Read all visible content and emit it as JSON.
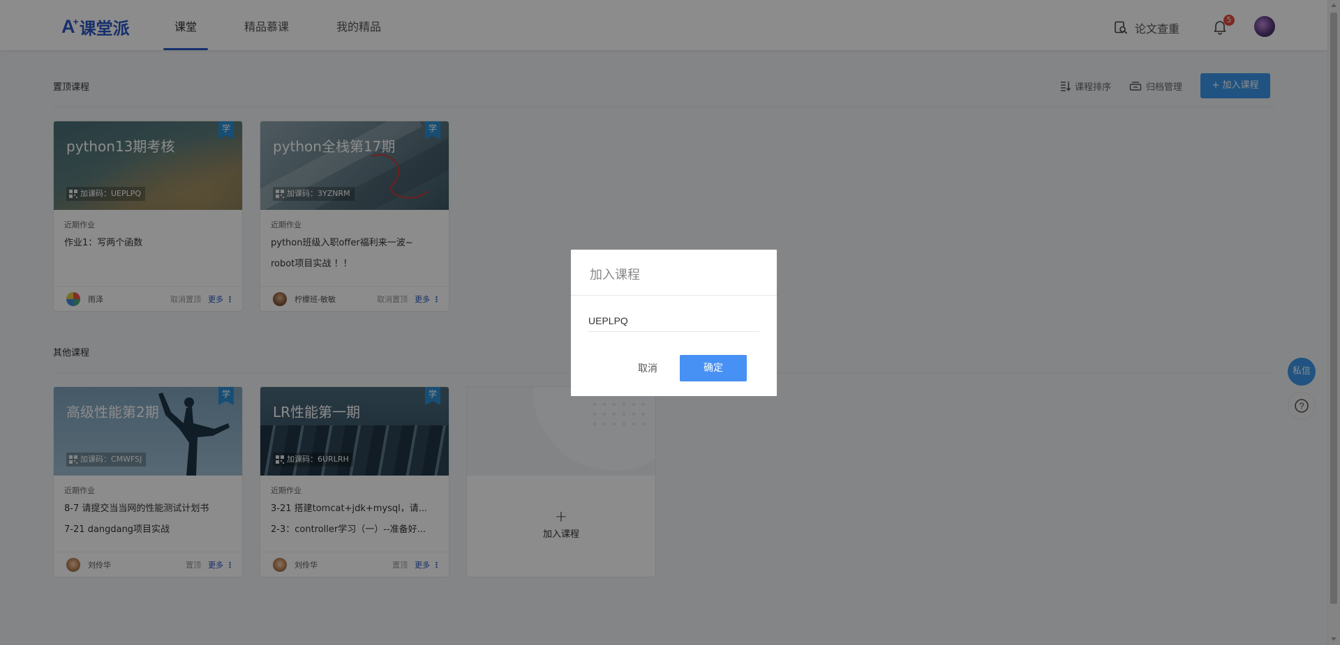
{
  "header": {
    "logo_mark": "A",
    "logo_sup": "+",
    "logo_text": "课堂派",
    "nav": [
      "课堂",
      "精品慕课",
      "我的精品"
    ],
    "plagiarism_label": "论文查重",
    "notification_count": "5"
  },
  "pinned": {
    "title": "置顶课程",
    "sort_label": "课程排序",
    "archive_label": "归档管理",
    "join_button": "+ 加入课程",
    "courses": [
      {
        "title": "python13期考核",
        "ribbon": "学",
        "code": "加课码：UEPLPQ",
        "hw_label": "近期作业",
        "homework": [
          "作业1：写两个函数"
        ],
        "teacher": "雨泽",
        "pin_action": "取消置顶",
        "more": "更多"
      },
      {
        "title": "python全栈第17期",
        "ribbon": "学",
        "code": "加课码：3YZNRM",
        "hw_label": "近期作业",
        "homework": [
          "python班级入职offer福利来一波~",
          "robot项目实战 ！！"
        ],
        "teacher": "柠檬班-敏敏",
        "pin_action": "取消置顶",
        "more": "更多"
      }
    ]
  },
  "others": {
    "title": "其他课程",
    "courses": [
      {
        "title": "高级性能第2期",
        "ribbon": "学",
        "code": "加课码：CMWFSJ",
        "hw_label": "近期作业",
        "homework": [
          "8-7 请提交当当网的性能测试计划书",
          "7-21 dangdang项目实战"
        ],
        "teacher": "刘伶华",
        "pin_action": "置顶",
        "more": "更多"
      },
      {
        "title": "LR性能第一期",
        "ribbon": "学",
        "code": "加课码：6URLRH",
        "hw_label": "近期作业",
        "homework": [
          "3-21 搭建tomcat+jdk+mysql，请...",
          "2-3：controller学习（一）--准备好..."
        ],
        "teacher": "刘伶华",
        "pin_action": "置顶",
        "more": "更多"
      }
    ],
    "add_plus": "+",
    "add_label": "加入课程"
  },
  "floating": {
    "message": "私信",
    "help": "?"
  },
  "modal": {
    "title": "加入课程",
    "input_value": "UEPLPQ",
    "cancel": "取消",
    "confirm": "确定"
  },
  "colors": {
    "brand": "#2b58c4",
    "accent": "#3b98ec",
    "confirm": "#4891f4",
    "badge": "#e24e3f"
  }
}
